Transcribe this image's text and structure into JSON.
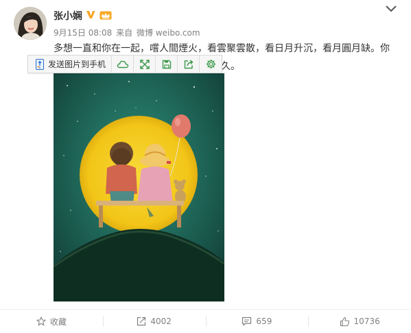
{
  "user": {
    "name": "张小娴"
  },
  "post": {
    "date": "9月15日 08:08",
    "source_prefix": "来自",
    "source": "微博 weibo.com",
    "text_line1": "多想一直和你在一起，嚐人間煙火，看雲聚雲散，看日月升沉，看月圓月缺。你",
    "text_line2": "長久。"
  },
  "toolbar": {
    "send_label": "发送图片到手机"
  },
  "actions": {
    "favorite_label": "收藏",
    "repost_count": "4002",
    "comment_count": "659",
    "like_count": "10736"
  },
  "icons": [
    "verified-v-icon",
    "member-crown-icon",
    "chevron-down-icon",
    "phone-send-icon",
    "cloud-icon",
    "expand-icon",
    "save-icon",
    "share-icon",
    "gear-icon",
    "star-icon",
    "repost-icon",
    "comment-icon",
    "thumbs-up-icon"
  ],
  "colors": {
    "accent_green": "#3b9a4a",
    "verified_orange": "#f6a623",
    "moon_yellow": "#f2c518",
    "sky_teal": "#1f6b5c"
  }
}
